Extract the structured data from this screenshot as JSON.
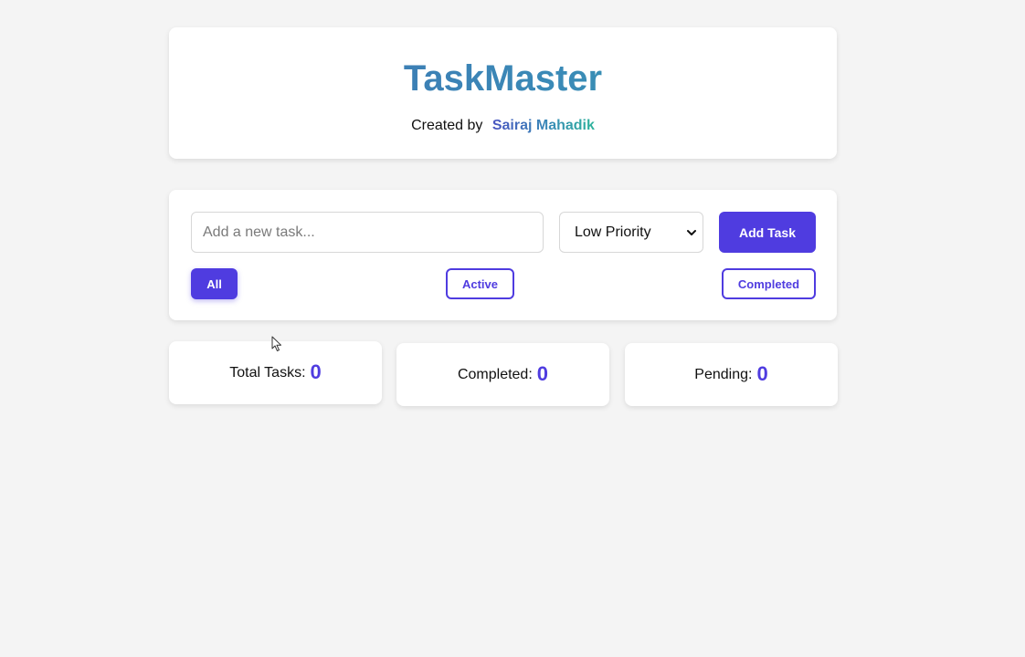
{
  "header": {
    "title": "TaskMaster",
    "credit_label": "Created by",
    "credit_name": "Sairaj Mahadik"
  },
  "task_form": {
    "input_value": "",
    "input_placeholder": "Add a new task...",
    "priority_selected": "Low Priority",
    "add_button_label": "Add Task"
  },
  "filters": {
    "all_label": "All",
    "active_label": "Active",
    "completed_label": "Completed",
    "selected": "All"
  },
  "stats": {
    "total_label": "Total Tasks:",
    "total_value": "0",
    "completed_label": "Completed:",
    "completed_value": "0",
    "pending_label": "Pending:",
    "pending_value": "0"
  },
  "icons": {
    "select_chevron": "chevron-down-icon",
    "pointer": "mouse-cursor-icon"
  },
  "colors": {
    "accent": "#4f3ce0",
    "background": "#f4f4f4",
    "card": "#ffffff",
    "title_gradient_start": "#3f6fb2",
    "title_gradient_end": "#2fa5a0"
  }
}
